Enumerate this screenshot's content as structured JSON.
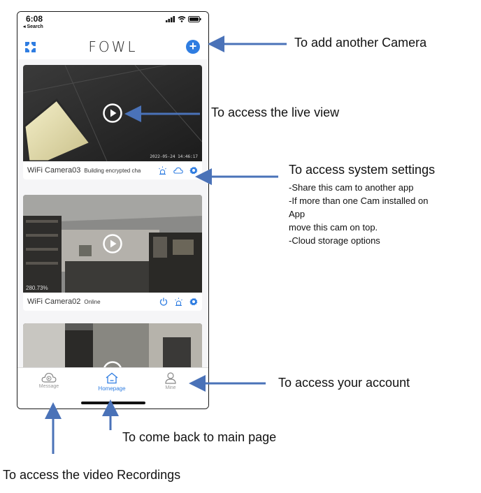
{
  "status_bar": {
    "time": "6:08",
    "back_label": "◂ Search"
  },
  "header": {
    "logo": "FOWL",
    "add_icon": "plus-icon",
    "menu_icon": "grid-icon"
  },
  "cameras": [
    {
      "name": "WiFi Camera03",
      "status": "Building encrypted cha",
      "timestamp": "2022-05-24 14:46:17",
      "overlay": ""
    },
    {
      "name": "WiFi Camera02",
      "status": "Online",
      "timestamp": "",
      "overlay": "280.73%"
    }
  ],
  "tabs": [
    {
      "label": "Message",
      "icon": "cloud-icon"
    },
    {
      "label": "Homepage",
      "icon": "home-icon"
    },
    {
      "label": "Mine",
      "icon": "person-icon"
    }
  ],
  "callouts": {
    "add_camera": "To add another Camera",
    "live_view": "To access the live view",
    "system_settings": "To access system settings",
    "settings_details": [
      "-Share this cam to another app",
      "-If more than one Cam installed on",
      "App",
      "move this cam on top.",
      "-Cloud storage options"
    ],
    "account": "To access your account",
    "main_page": "To come back to main page",
    "recordings": "To access the video Recordings"
  },
  "colors": {
    "accent": "#2f7de1",
    "arrow": "#4a72b8"
  }
}
